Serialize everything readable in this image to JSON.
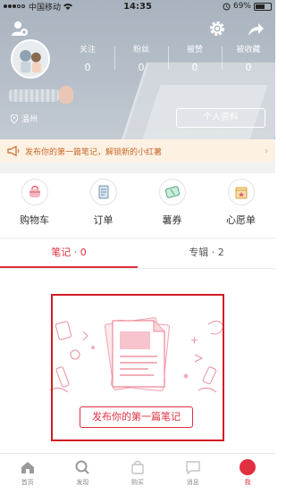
{
  "status_bar": {
    "carrier": "中国移动",
    "time": "14:35",
    "battery": "69%",
    "battery_level": 0.69
  },
  "profile": {
    "stats": [
      {
        "label": "关注",
        "value": "0"
      },
      {
        "label": "粉丝",
        "value": "0"
      },
      {
        "label": "被赞",
        "value": "0"
      },
      {
        "label": "被收藏",
        "value": "0"
      }
    ],
    "location": "温州",
    "edit_button": "个人资料"
  },
  "notice": {
    "text": "发布你的第一篇笔记，解锁新的小红薯",
    "arrow": "›"
  },
  "shortcuts": [
    {
      "label": "购物车",
      "icon": "shopping-cart-icon"
    },
    {
      "label": "订单",
      "icon": "order-list-icon"
    },
    {
      "label": "薯券",
      "icon": "coupon-icon"
    },
    {
      "label": "心愿单",
      "icon": "wishlist-icon"
    }
  ],
  "tabs": [
    {
      "label": "笔记 · 0",
      "active": true
    },
    {
      "label": "专辑 · 2",
      "active": false
    }
  ],
  "empty_state": {
    "publish_button": "发布你的第一篇笔记"
  },
  "bottom_nav": [
    {
      "label": "首页",
      "icon": "home-icon"
    },
    {
      "label": "发现",
      "icon": "search-icon"
    },
    {
      "label": "购买",
      "icon": "shopping-icon"
    },
    {
      "label": "消息",
      "icon": "message-icon"
    },
    {
      "label": "我",
      "icon": "me-icon",
      "active": true
    }
  ],
  "colors": {
    "accent": "#e03040",
    "highlight_box": "#d01c24",
    "header_bg": "#b7c0ca",
    "notice_bg": "#fdf1e4",
    "notice_text": "#c96a2a"
  }
}
